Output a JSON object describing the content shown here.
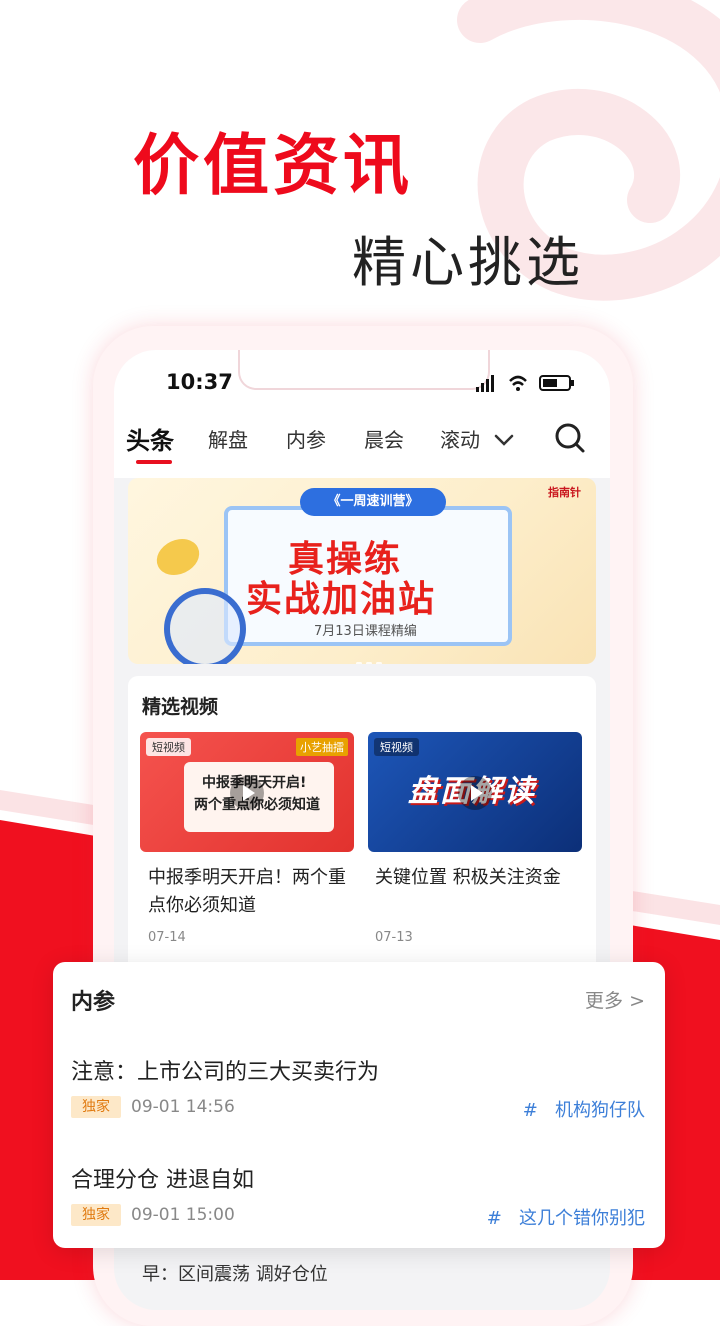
{
  "promo": {
    "headline": "价值资讯",
    "subline": "精心挑选"
  },
  "status_bar": {
    "time": "10:37"
  },
  "tabs": [
    {
      "label": "头条",
      "active": true
    },
    {
      "label": "解盘"
    },
    {
      "label": "内参"
    },
    {
      "label": "晨会"
    },
    {
      "label": "滚动"
    }
  ],
  "banner": {
    "pill": "《一周速训营》",
    "line1": "真操练",
    "line2": "实战加油站",
    "caption": "7月13日课程精编",
    "logo": "指南针"
  },
  "videos": {
    "section_title": "精选视频",
    "items": [
      {
        "tag": "短视频",
        "corner": "小艺抽擂",
        "thumb_line1": "中报季明天开启!",
        "thumb_line2": "两个重点你必须知道",
        "caption": "中报季明天开启！两个重点你必须知道",
        "date": "07-14"
      },
      {
        "tag": "短视频",
        "thumb_title": "盘面解读",
        "caption": "关键位置 积极关注资金",
        "date": "07-13"
      }
    ]
  },
  "bottom_peek": "早：区间震荡 调好仓位",
  "neican": {
    "title": "内参",
    "more": "更多 >",
    "items": [
      {
        "title": "注意：上市公司的三大买卖行为",
        "badge": "独家",
        "time": "09-01 14:56",
        "tag": "机构狗仔队"
      },
      {
        "title": "合理分仓 进退自如",
        "badge": "独家",
        "time": "09-01 15:00",
        "tag": "这几个错你别犯"
      }
    ]
  },
  "colors": {
    "brand_red": "#ee0a1c",
    "link_blue": "#3d7fd8"
  }
}
